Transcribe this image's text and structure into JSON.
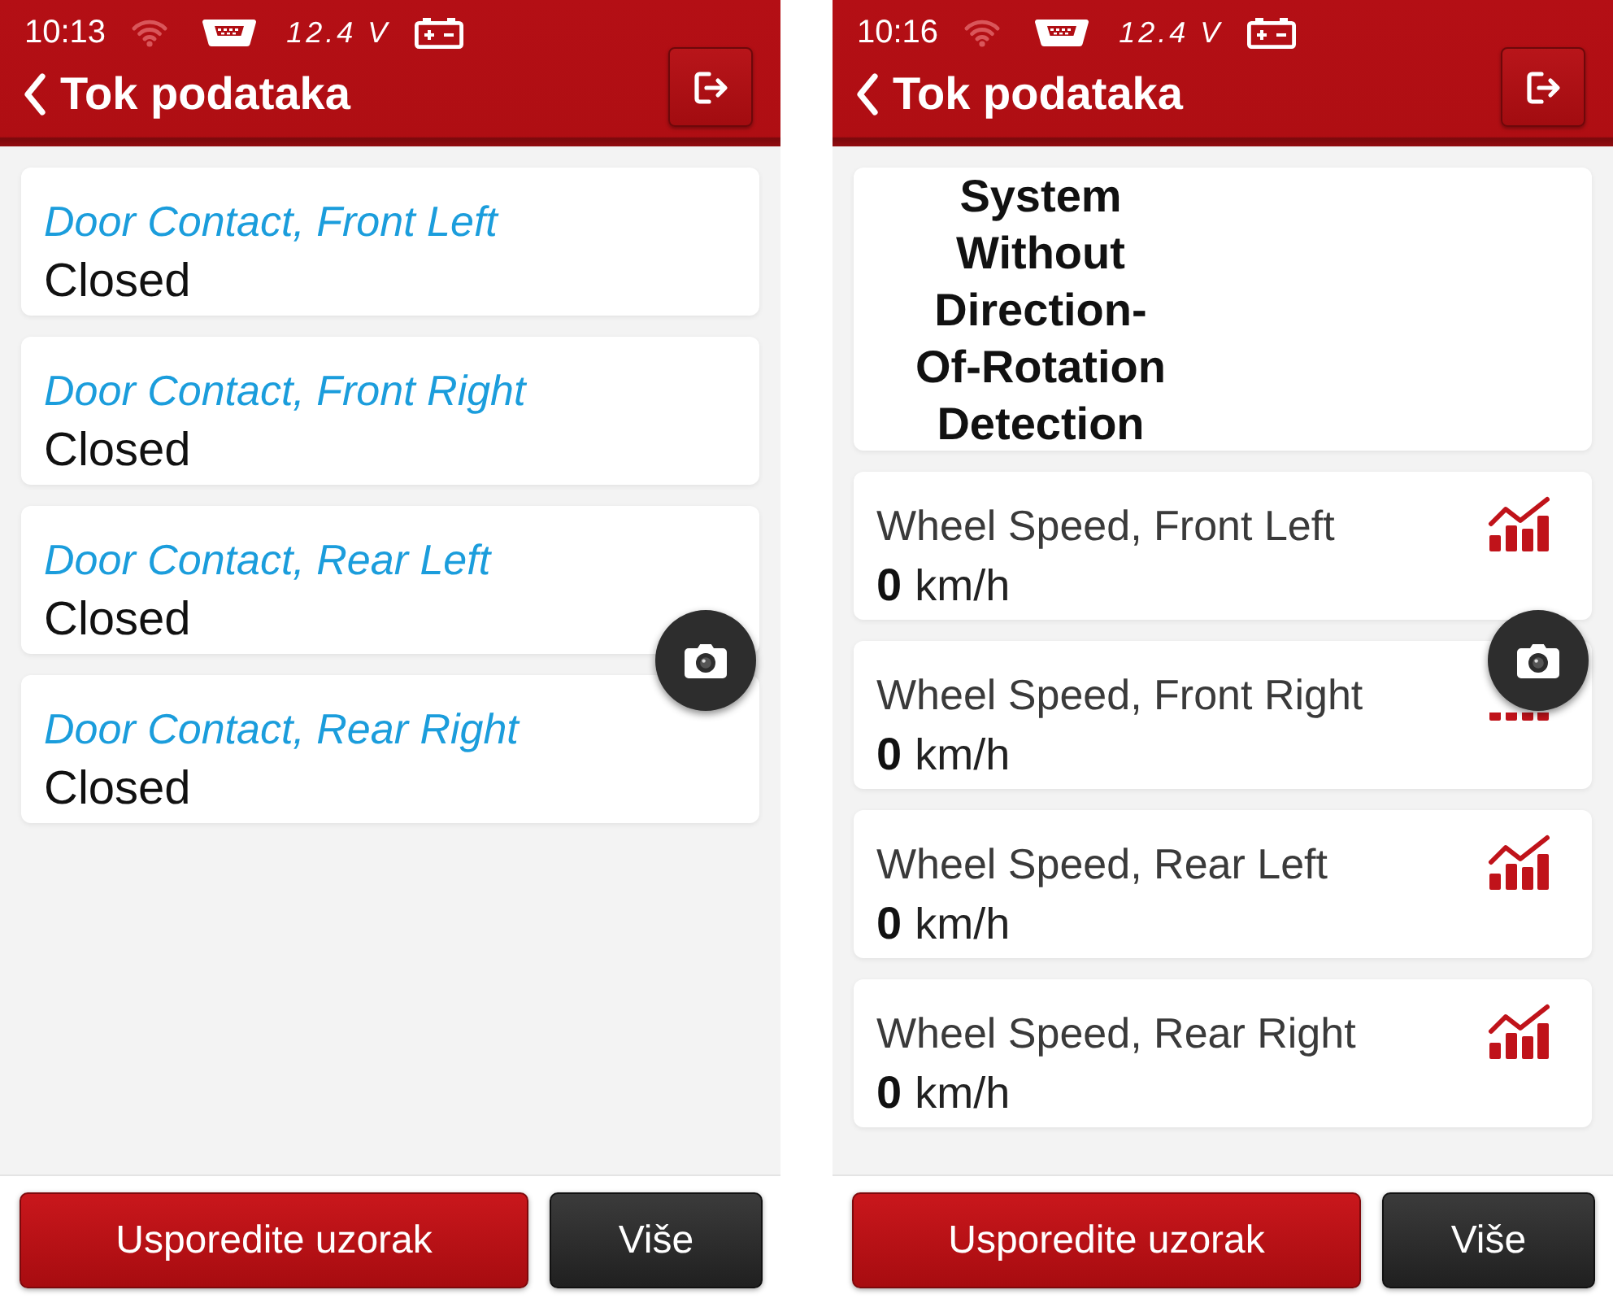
{
  "screens": [
    {
      "status_bar": {
        "time": "10:13",
        "voltage": "12.4 V"
      },
      "title": "Tok podataka",
      "items": [
        {
          "kind": "status",
          "label": "Door Contact, Front Left",
          "value": "Closed"
        },
        {
          "kind": "status",
          "label": "Door Contact, Front Right",
          "value": "Closed"
        },
        {
          "kind": "status",
          "label": "Door Contact, Rear Left",
          "value": "Closed"
        },
        {
          "kind": "status",
          "label": "Door Contact, Rear Right",
          "value": "Closed"
        }
      ],
      "buttons": [
        {
          "kind": "primary",
          "label": "Usporedite uzorak"
        },
        {
          "kind": "secondary",
          "label": "Više"
        }
      ]
    },
    {
      "status_bar": {
        "time": "10:16",
        "voltage": "12.4 V"
      },
      "title": "Tok podataka",
      "items": [
        {
          "kind": "note",
          "text": "System Without Direction-Of-Rotation Detection"
        },
        {
          "kind": "reading",
          "label": "Wheel Speed, Front Left",
          "value": "0",
          "unit": "km/h"
        },
        {
          "kind": "reading",
          "label": "Wheel Speed, Front Right",
          "value": "0",
          "unit": "km/h"
        },
        {
          "kind": "reading",
          "label": "Wheel Speed, Rear Left",
          "value": "0",
          "unit": "km/h"
        },
        {
          "kind": "reading",
          "label": "Wheel Speed, Rear Right",
          "value": "0",
          "unit": "km/h"
        }
      ],
      "buttons": [
        {
          "kind": "primary",
          "label": "Usporedite uzorak"
        },
        {
          "kind": "secondary",
          "label": "Više"
        }
      ]
    }
  ]
}
